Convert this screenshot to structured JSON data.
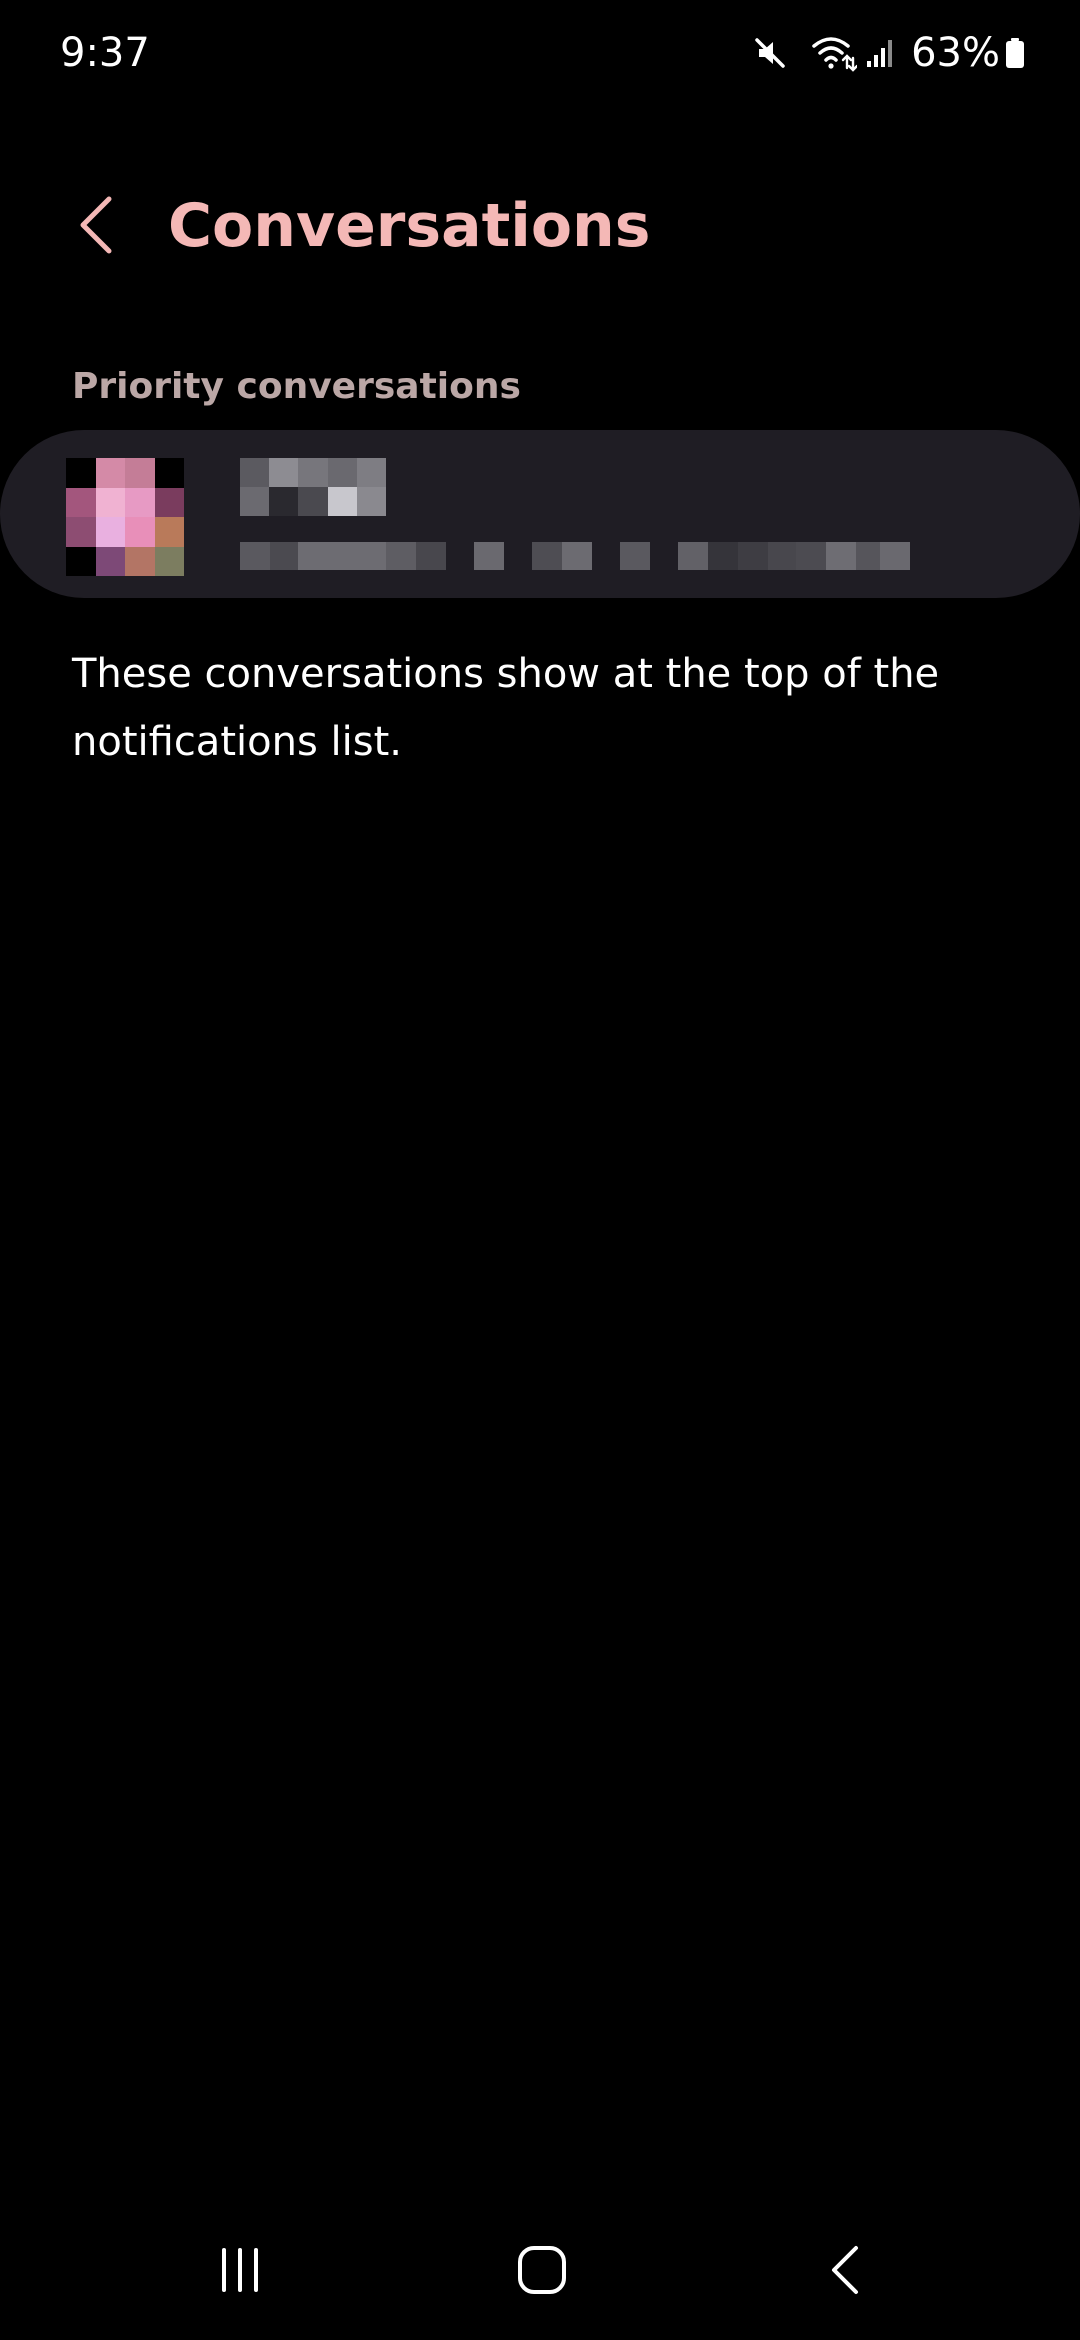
{
  "status_bar": {
    "time": "9:37",
    "battery_percent": "63%",
    "icons": [
      "mute-icon",
      "wifi-icon",
      "signal-icon",
      "battery-icon"
    ]
  },
  "header": {
    "title": "Conversations",
    "back_icon": "chevron-left-icon"
  },
  "section": {
    "title": "Priority conversations"
  },
  "conversations": [
    {
      "name": "",
      "preview": "",
      "redacted": true
    }
  ],
  "description": "These conversations show at the top of the notifications list.",
  "nav_bar": {
    "icons": [
      "recents-icon",
      "home-icon",
      "back-icon"
    ]
  },
  "colors": {
    "background": "#000000",
    "accent_title": "#f4b8b6",
    "section_header": "#bba7a6",
    "card_background": "#1f1d24",
    "text": "#ffffff"
  }
}
